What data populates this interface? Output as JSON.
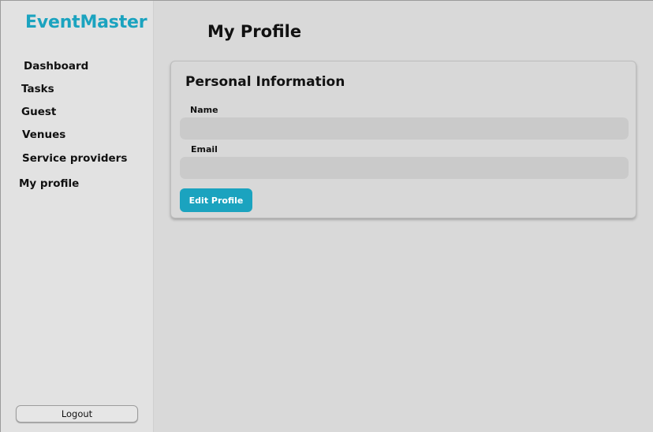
{
  "app": {
    "brand": "EventMaster",
    "accent_color": "#1ba3bf"
  },
  "sidebar": {
    "items": [
      {
        "label": "Dashboard"
      },
      {
        "label": "Tasks"
      },
      {
        "label": "Guest"
      },
      {
        "label": "Venues"
      },
      {
        "label": "Service providers"
      },
      {
        "label": "My profile"
      }
    ],
    "logout_label": "Logout"
  },
  "main": {
    "title": "My Profile",
    "card": {
      "title": "Personal Information",
      "fields": [
        {
          "label": "Name",
          "value": "",
          "placeholder": ""
        },
        {
          "label": "Email",
          "value": "",
          "placeholder": ""
        }
      ],
      "edit_label": "Edit Profile"
    }
  }
}
